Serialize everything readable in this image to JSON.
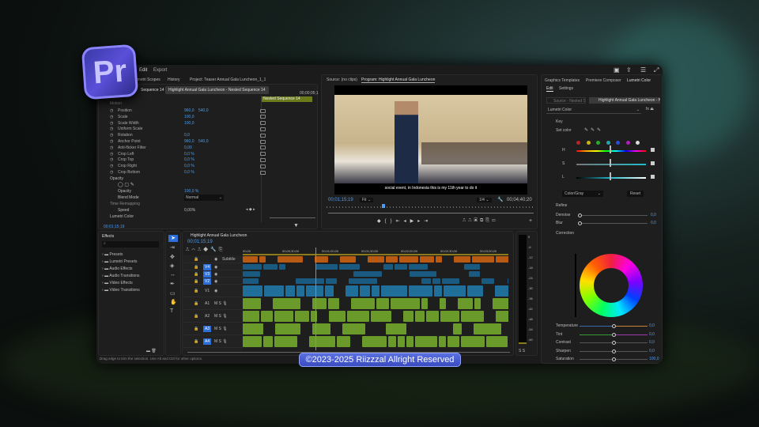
{
  "menu": {
    "items": [
      "Edit",
      "Export"
    ]
  },
  "logo": "Pr",
  "left_tabs": [
    "Lumetri Scopes",
    "History",
    "Project: Teaser Annual Gala Luncheon_1_1"
  ],
  "effect_controls": {
    "source_tab": "Sequence 14",
    "clip_tab": "Highlight Annual Gala Luncheon - Nested Sequence 14",
    "time_ruler": "00;00;05;1",
    "nested_clip": "Nested Sequence 14",
    "section_motion": "Motion",
    "rows": [
      {
        "label": "Position",
        "v1": "960,0",
        "v2": "540,0"
      },
      {
        "label": "Scale",
        "v1": "100,0",
        "v2": ""
      },
      {
        "label": "Scale Width",
        "v1": "100,0",
        "v2": ""
      },
      {
        "label": "Uniform Scale",
        "v1": "",
        "v2": ""
      },
      {
        "label": "Rotation",
        "v1": "0,0",
        "v2": ""
      },
      {
        "label": "Anchor Point",
        "v1": "960,0",
        "v2": "540,0"
      },
      {
        "label": "Anti-flicker Filter",
        "v1": "0,00",
        "v2": ""
      },
      {
        "label": "Crop Left",
        "v1": "0,0 %",
        "v2": ""
      },
      {
        "label": "Crop Top",
        "v1": "0,0 %",
        "v2": ""
      },
      {
        "label": "Crop Right",
        "v1": "0,0 %",
        "v2": ""
      },
      {
        "label": "Crop Bottom",
        "v1": "0,0 %",
        "v2": ""
      }
    ],
    "section_opacity": "Opacity",
    "opacity_label": "Opacity",
    "opacity_value": "100,0 %",
    "blend_label": "Blend Mode",
    "blend_value": "Normal",
    "section_time": "Time Remapping",
    "speed_label": "Speed",
    "speed_value": "0,00%",
    "section_lumetri": "Lumetri Color",
    "timecode": "00;01;15;19"
  },
  "program": {
    "source_tab": "Source: (no clips)",
    "program_tab": "Program: Highlight Annual Gala Luncheon",
    "subtitle": "social event, in Indonesia this is my 11th year to do it",
    "timecode": "00;01;15;19",
    "fit": "Fit",
    "resolution": "1/4",
    "duration": "00;04;40;20"
  },
  "right_panel": {
    "tabs": [
      "Graphics Templates",
      "Premiere Composer",
      "Lumetri Color"
    ],
    "subtabs": [
      "Edit",
      "Settings"
    ],
    "source_btn": "Source - Nested Se...",
    "clip_btn": "Highlight Annual Gala Luncheon - Nest...",
    "effect_select": "Lumetri Color",
    "key_label": "Key",
    "set_color": "Set color",
    "swatches": [
      "#c0202a",
      "#c8b21c",
      "#2aa830",
      "#1fa8a8",
      "#2a4ae0",
      "#b020b8",
      "#dddddd"
    ],
    "hsl": [
      "H",
      "S",
      "L"
    ],
    "colorgray": "Color/Gray",
    "reset": "Reset",
    "refine": "Refine",
    "denoise": {
      "label": "Denoise",
      "value": "0,0"
    },
    "blur": {
      "label": "Blur",
      "value": "0,0"
    },
    "correction": "Correction",
    "sliders": [
      {
        "label": "Temperature",
        "value": "0,0"
      },
      {
        "label": "Tint",
        "value": "0,0"
      },
      {
        "label": "Contrast",
        "value": "0,0"
      },
      {
        "label": "Sharpen",
        "value": "0,0"
      },
      {
        "label": "Saturation",
        "value": "100,0"
      }
    ]
  },
  "effects": {
    "title": "Effects",
    "items": [
      "Presets",
      "Lumetri Presets",
      "Audio Effects",
      "Audio Transitions",
      "Video Effects",
      "Video Transitions"
    ]
  },
  "timeline": {
    "title": "Highlight Annual Gala Luncheon",
    "timecode": "00;01;15;19",
    "ruler": [
      "00;00",
      "00;00;30;00",
      "00;01;00;00",
      "00;01;30;00",
      "00;02;00;00",
      "00;02;30;00",
      "00;03;00;00"
    ],
    "subtitle_track": "Subtitle",
    "video_tracks": [
      "V4",
      "V3",
      "V2",
      "V1"
    ],
    "audio_tracks": [
      "A1",
      "A2",
      "A3",
      "A4"
    ],
    "meter_ticks": [
      "0",
      "-6",
      "-12",
      "-18",
      "-24",
      "-30",
      "-36",
      "-42",
      "-48",
      "-54",
      "-60"
    ],
    "meter_solo": "S S"
  },
  "status": "Drag edge to trim the selection. Use Alt and Ctrl for other options.",
  "watermark": "©2023-2025 Riizzzal Allright Reserved"
}
